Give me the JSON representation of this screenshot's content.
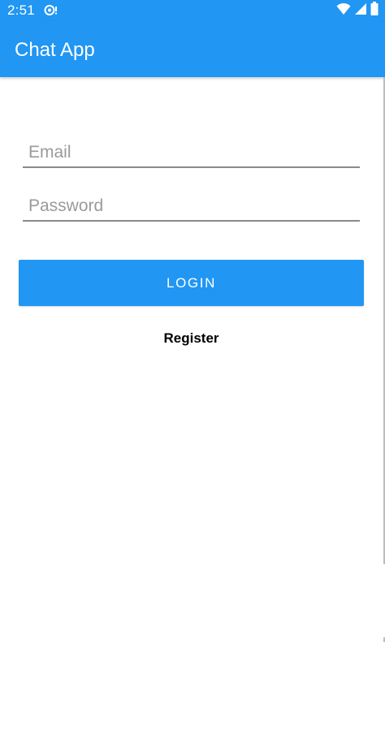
{
  "status_bar": {
    "time": "2:51",
    "notification_icon": "chat-bubble-icon",
    "icons": [
      "wifi-icon",
      "cellular-signal-icon",
      "battery-icon"
    ]
  },
  "app_bar": {
    "title": "Chat App"
  },
  "login_form": {
    "email_placeholder": "Email",
    "email_value": "",
    "password_placeholder": "Password",
    "password_value": "",
    "login_label": "LOGIN",
    "register_label": "Register"
  },
  "colors": {
    "primary": "#2196F3",
    "on_primary": "#FFFFFF",
    "underline": "#8A8A8A",
    "placeholder": "#9A9A9A",
    "background": "#FFFFFF"
  }
}
